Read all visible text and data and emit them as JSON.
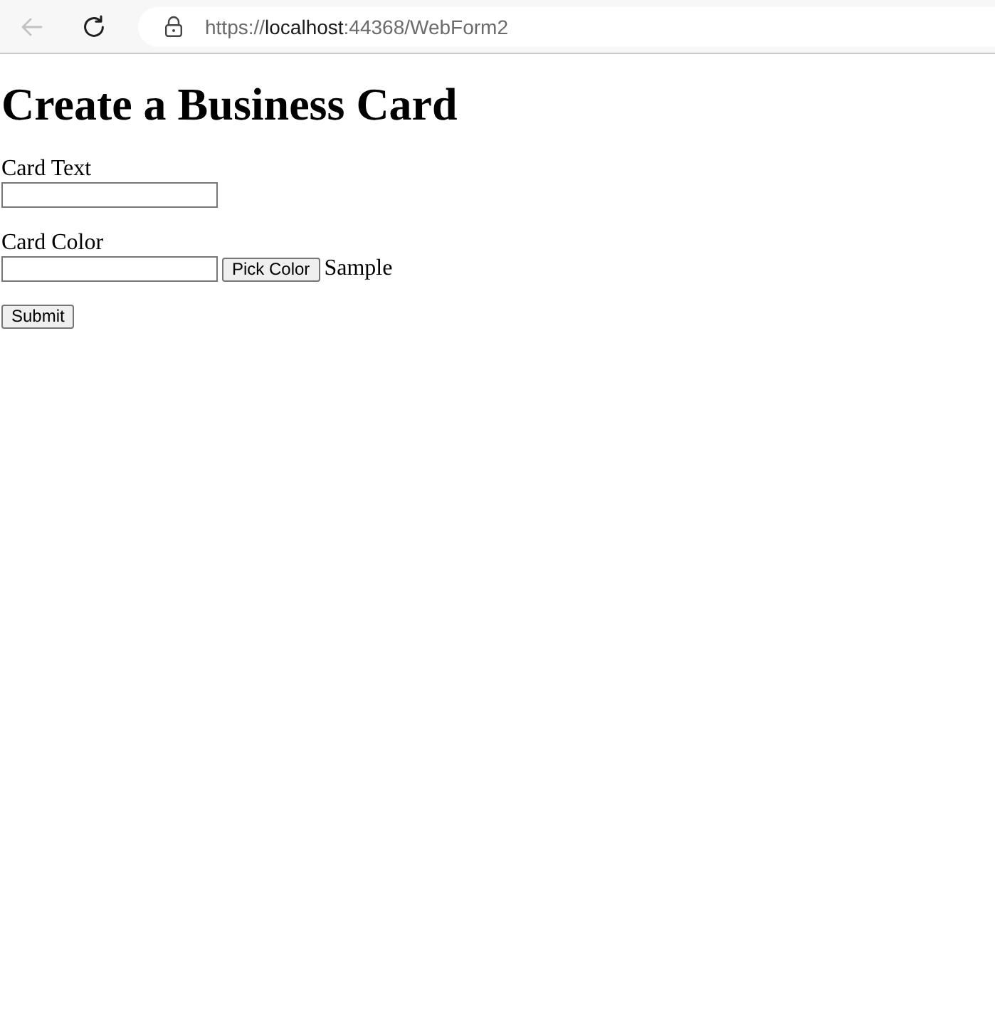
{
  "browser": {
    "back_button": {
      "disabled": true
    },
    "address_bar": {
      "url_parts": [
        {
          "text": "https://",
          "emphasis": false
        },
        {
          "text": "localhost",
          "emphasis": true
        },
        {
          "text": ":44368/WebForm2",
          "emphasis": false
        }
      ]
    }
  },
  "page": {
    "heading": "Create a Business Card",
    "fields": [
      {
        "kind": "text",
        "label": "Card Text"
      },
      {
        "kind": "color",
        "label": "Card Color",
        "button": "Pick Color",
        "sample": "Sample"
      }
    ],
    "submit": "Submit"
  }
}
